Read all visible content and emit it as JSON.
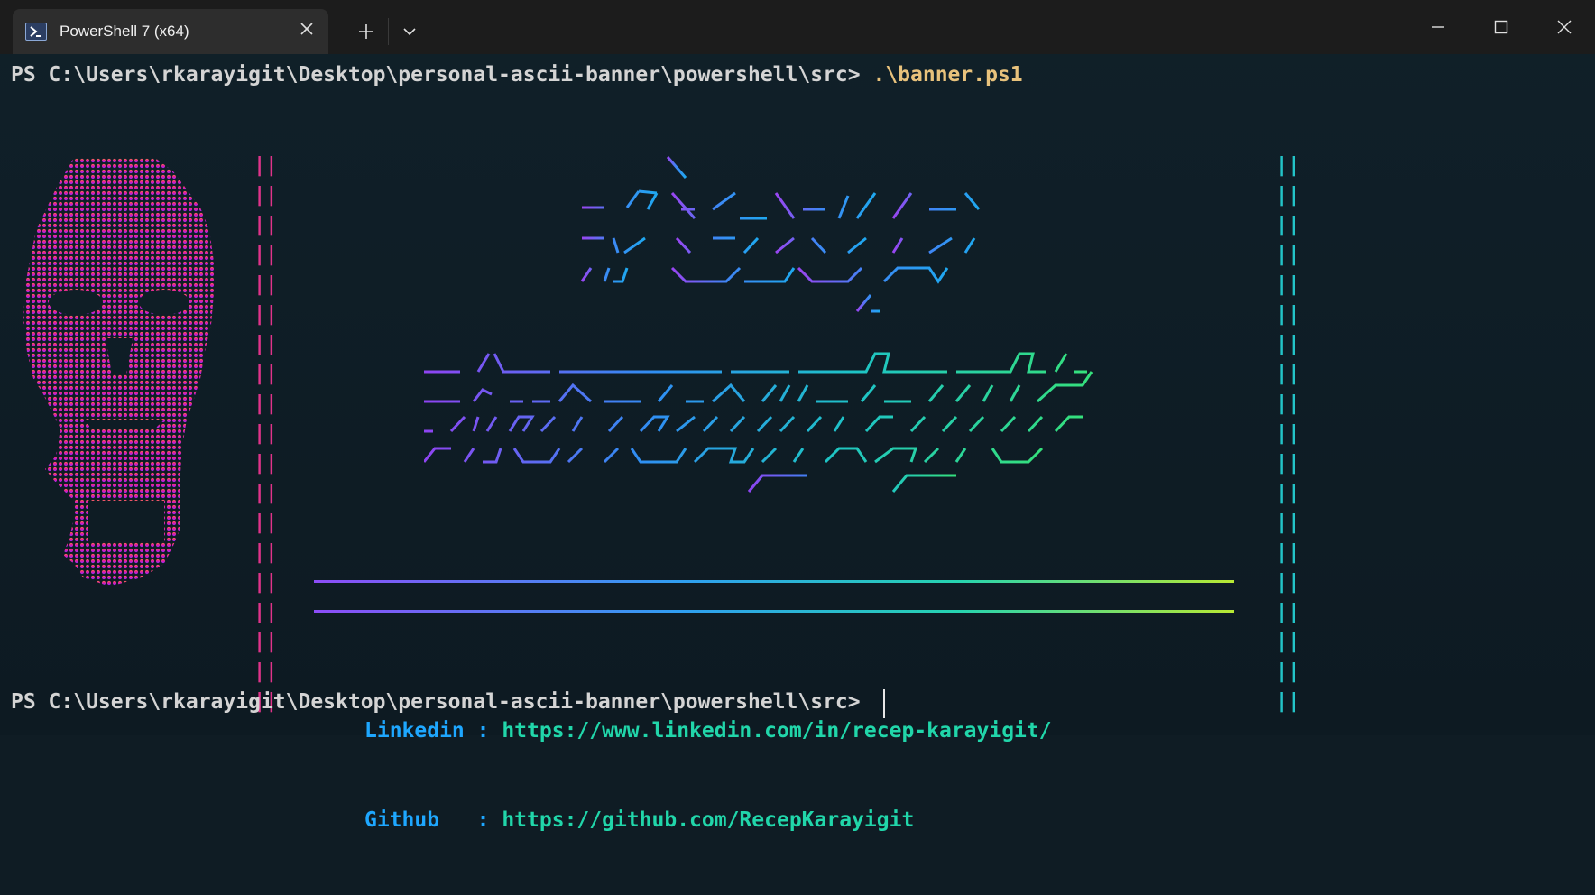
{
  "window": {
    "tab_title": "PowerShell 7 (x64)"
  },
  "terminal": {
    "prompt_1": "PS C:\\Users\\rkarayigit\\Desktop\\personal-ascii-banner\\powershell\\src> ",
    "command_1": ".\\banner.ps1",
    "prompt_2": "PS C:\\Users\\rkarayigit\\Desktop\\personal-ascii-banner\\powershell\\src> "
  },
  "banner": {
    "links": [
      {
        "label": "Linkedin : ",
        "url": "https://www.linkedin.com/in/recep-karayigit/"
      },
      {
        "label": "Github   : ",
        "url": "https://github.com/RecepKarayigit"
      }
    ]
  },
  "colors": {
    "background": "#0f1c24",
    "left_bar": "#e0338a",
    "right_bar": "#23c4c8",
    "command": "#e8c27c",
    "link_label": "#1ea7ff",
    "link_url": "#21d6aa"
  }
}
